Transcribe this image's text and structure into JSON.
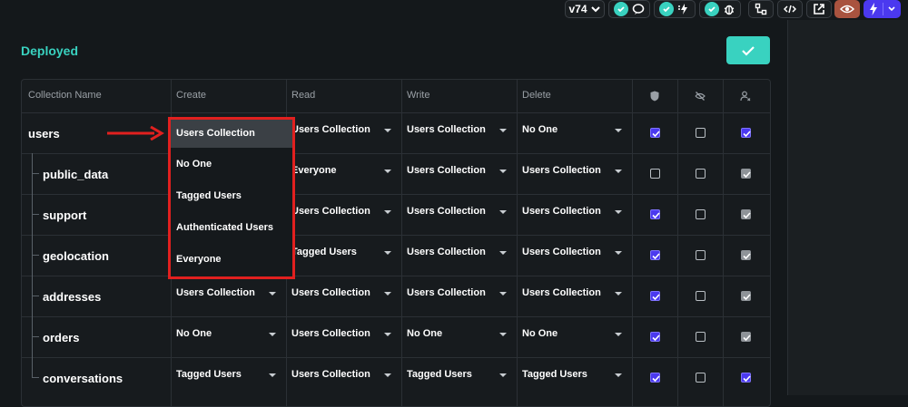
{
  "toolbar": {
    "version_label": "v74"
  },
  "page": {
    "deployed_label": "Deployed"
  },
  "table": {
    "headers": [
      "Collection Name",
      "Create",
      "Read",
      "Write",
      "Delete"
    ],
    "rows": [
      {
        "name": "users",
        "create": "",
        "read": "Users Collection",
        "write": "Users Collection",
        "delete": "No One"
      },
      {
        "name": "public_data",
        "create": "",
        "read": "Everyone",
        "write": "Users Collection",
        "delete": "Users Collection"
      },
      {
        "name": "support",
        "create": "",
        "read": "Users Collection",
        "write": "Users Collection",
        "delete": "Users Collection"
      },
      {
        "name": "geolocation",
        "create": "",
        "read": "Tagged Users",
        "write": "Users Collection",
        "delete": "Users Collection"
      },
      {
        "name": "addresses",
        "create": "Users Collection",
        "read": "Users Collection",
        "write": "Users Collection",
        "delete": "Users Collection"
      },
      {
        "name": "orders",
        "create": "No One",
        "read": "Users Collection",
        "write": "No One",
        "delete": "No One"
      },
      {
        "name": "conversations",
        "create": "Tagged Users",
        "read": "Users Collection",
        "write": "Tagged Users",
        "delete": "Tagged Users"
      }
    ],
    "checkbox_states": [
      [
        "on",
        "off",
        "on"
      ],
      [
        "off",
        "off",
        "grey"
      ],
      [
        "on",
        "off",
        "grey"
      ],
      [
        "on",
        "off",
        "grey"
      ],
      [
        "on",
        "off",
        "grey"
      ],
      [
        "on",
        "off",
        "grey"
      ],
      [
        "on",
        "off",
        "on"
      ]
    ],
    "column_icons": [
      "shield-icon",
      "eye-off-icon",
      "user-x-icon"
    ]
  },
  "dropdown": {
    "options": [
      "Users Collection",
      "No One",
      "Tagged Users",
      "Authenticated Users",
      "Everyone"
    ],
    "selected": "Users Collection"
  },
  "colors": {
    "accent": "#39d2c0",
    "checkbox_on": "#4b39ef",
    "highlight": "#e1201f"
  }
}
